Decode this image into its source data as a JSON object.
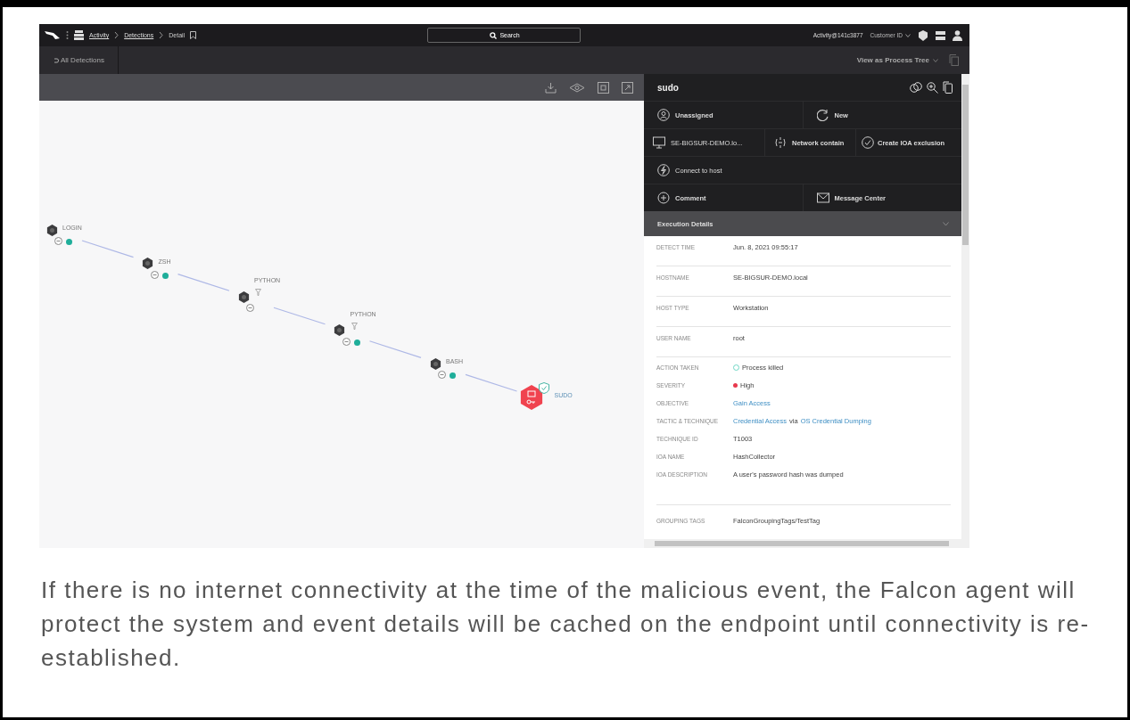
{
  "top_bar": {
    "breadcrumbs": [
      {
        "label": "Activity",
        "link": true
      },
      {
        "label": "Detections",
        "link": true
      },
      {
        "label": "Detail",
        "link": false
      }
    ],
    "search": {
      "placeholder": "Search"
    },
    "account": "Activity@141c3877",
    "customer_menu": "Customer ID"
  },
  "sub_bar": {
    "back_link": "All Detections",
    "view_menu": "View as Process Tree"
  },
  "graph": {
    "nodes": [
      {
        "label": "LOGIN",
        "kind": "process",
        "filter_marker": false,
        "collapse_control": true,
        "status_dot": true
      },
      {
        "label": "ZSH",
        "kind": "process",
        "filter_marker": false,
        "collapse_control": true,
        "status_dot": true
      },
      {
        "label": "PYTHON",
        "kind": "process",
        "filter_marker": true,
        "collapse_control": true,
        "status_dot": false
      },
      {
        "label": "PYTHON",
        "kind": "process",
        "filter_marker": true,
        "collapse_control": true,
        "status_dot": true
      },
      {
        "label": "BASH",
        "kind": "process",
        "filter_marker": false,
        "collapse_control": true,
        "status_dot": true
      },
      {
        "label": "SUDO",
        "kind": "detection",
        "filter_marker": false,
        "collapse_control": false,
        "status_dot": false
      }
    ]
  },
  "panel": {
    "title": "sudo",
    "actions": [
      [
        {
          "label": "Unassigned",
          "kind": "assignee",
          "emphasis": true
        },
        {
          "label": "New",
          "kind": "status",
          "emphasis": true
        }
      ],
      [
        {
          "label": "SE-BIGSUR-DEMO.lo...",
          "kind": "host",
          "emphasis": false
        },
        {
          "label": "Network contain",
          "kind": "contain",
          "emphasis": true
        },
        {
          "label": "Create IOA exclusion",
          "kind": "exclusion",
          "emphasis": true
        }
      ],
      [
        {
          "label": "Connect to host",
          "kind": "connect",
          "emphasis": false
        }
      ],
      [
        {
          "label": "Comment",
          "kind": "comment",
          "emphasis": true
        },
        {
          "label": "Message Center",
          "kind": "message",
          "emphasis": true
        }
      ]
    ],
    "section_title": "Execution Details",
    "detail_sections": [
      [
        {
          "label": "DETECT TIME",
          "kind": "text",
          "value": "Jun. 8, 2021 09:55:17"
        }
      ],
      [
        {
          "label": "HOSTNAME",
          "kind": "text",
          "value": "SE-BIGSUR-DEMO.local"
        }
      ],
      [
        {
          "label": "HOST TYPE",
          "kind": "text",
          "value": "Workstation"
        }
      ],
      [
        {
          "label": "USER NAME",
          "kind": "text",
          "value": "root"
        }
      ],
      [
        {
          "label": "ACTION TAKEN",
          "kind": "status",
          "value": "Process killed"
        },
        {
          "label": "SEVERITY",
          "kind": "severity",
          "value": "High"
        },
        {
          "label": "OBJECTIVE",
          "kind": "link",
          "value": "Gain Access"
        },
        {
          "label": "TACTIC & TECHNIQUE",
          "kind": "tactic",
          "tactic": "Credential Access",
          "joiner": "via",
          "technique": "OS Credential Dumping"
        },
        {
          "label": "TECHNIQUE ID",
          "kind": "text",
          "value": "T1003"
        },
        {
          "label": "IOA NAME",
          "kind": "text",
          "value": "HashCollector"
        },
        {
          "label": "IOA DESCRIPTION",
          "kind": "text",
          "value": "A user's password hash was dumped"
        }
      ],
      [
        {
          "label": "GROUPING TAGS",
          "kind": "text",
          "value": "FalconGroupingTags/TestTag"
        }
      ]
    ]
  },
  "caption": "If there is no internet connectivity at the time of the malicious event, the Falcon agent will protect the system and event details will be cached on the endpoint until connectivity is re-established."
}
